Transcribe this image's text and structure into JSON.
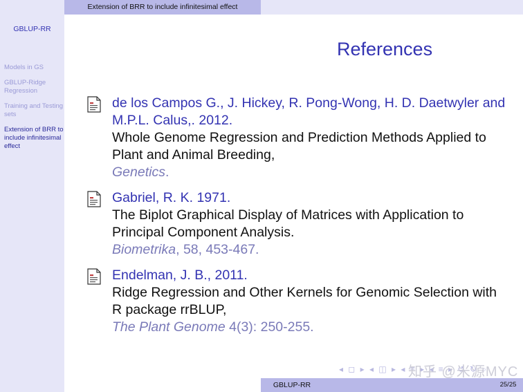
{
  "header": {
    "section_title": "Extension of BRR to include infinitesimal effect"
  },
  "sidebar": {
    "short_title": "GBLUP-RR",
    "items": [
      {
        "label": "Models in GS",
        "active": false
      },
      {
        "label": "GBLUP-Ridge Regression",
        "active": false
      },
      {
        "label": "Training and Testing sets",
        "active": false
      },
      {
        "label": "Extension of BRR to include infinitesimal effect",
        "active": true
      }
    ]
  },
  "frame": {
    "title": "References"
  },
  "references": [
    {
      "authors": "de los Campos G., J. Hickey, R. Pong-Wong, H. D. Daetwyler and M.P.L. Calus,. 2012.",
      "title": "Whole Genome Regression and Prediction Methods Applied to Plant and Animal Breeding,",
      "journal": "Genetics",
      "journal_rest": "."
    },
    {
      "authors": "Gabriel, R. K. 1971.",
      "title": "The Biplot Graphical Display of Matrices with Application to Principal Component Analysis.",
      "journal": "Biometrika",
      "journal_rest": ", 58, 453-467."
    },
    {
      "authors": "Endelman, J. B., 2011.",
      "title": "Ridge Regression and Other Kernels for Genomic Selection with R package rrBLUP,",
      "journal": "The Plant Genome",
      "journal_rest": " 4(3): 250-255."
    }
  ],
  "footer": {
    "short_title": "GBLUP-RR",
    "page_number": "25/25",
    "nav_symbols": "◂ ◻ ▸ ◂ ◫ ▸ ◂ ≡ ▸ ◂ ≡ ▸ ↺ ↻ ⌕",
    "watermark": "知乎 @米源MYC"
  },
  "colors": {
    "beamer_blue": "#3333b2",
    "sidebar_bg": "#e6e6f8",
    "bar_bg": "#b8b8e8"
  },
  "icons": [
    "bibliography-entry-icon"
  ]
}
